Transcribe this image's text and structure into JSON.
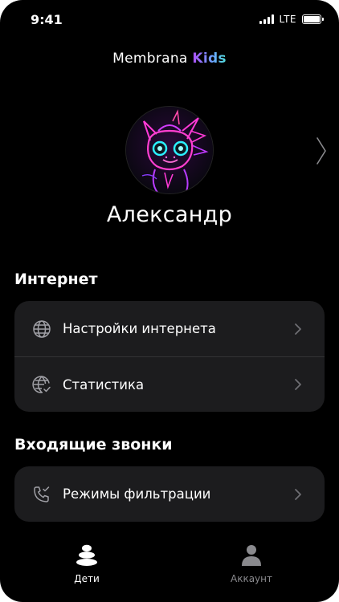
{
  "status_bar": {
    "time": "9:41",
    "network": "LTE"
  },
  "logo": {
    "brand": "Membrana",
    "sub": "Kids"
  },
  "profile": {
    "name": "Александр",
    "avatar_icon": "neon-dragon-avatar"
  },
  "sections": {
    "internet": {
      "title": "Интернет",
      "items": [
        {
          "label": "Настройки интернета",
          "icon": "globe-icon"
        },
        {
          "label": "Статистика",
          "icon": "globe-check-icon"
        }
      ]
    },
    "calls": {
      "title": "Входящие звонки",
      "items": [
        {
          "label": "Режимы фильтрации",
          "icon": "phone-check-icon"
        }
      ]
    }
  },
  "tabs": [
    {
      "label": "Дети",
      "icon": "stones-icon",
      "active": true
    },
    {
      "label": "Аккаунт",
      "icon": "person-icon",
      "active": false
    }
  ],
  "colors": {
    "background": "#000000",
    "card": "#1c1c1e",
    "divider": "#333335",
    "accent_gradient": [
      "#b04cff",
      "#6aa3ff",
      "#4fe0d8"
    ],
    "inactive": "#8a8a8e"
  }
}
